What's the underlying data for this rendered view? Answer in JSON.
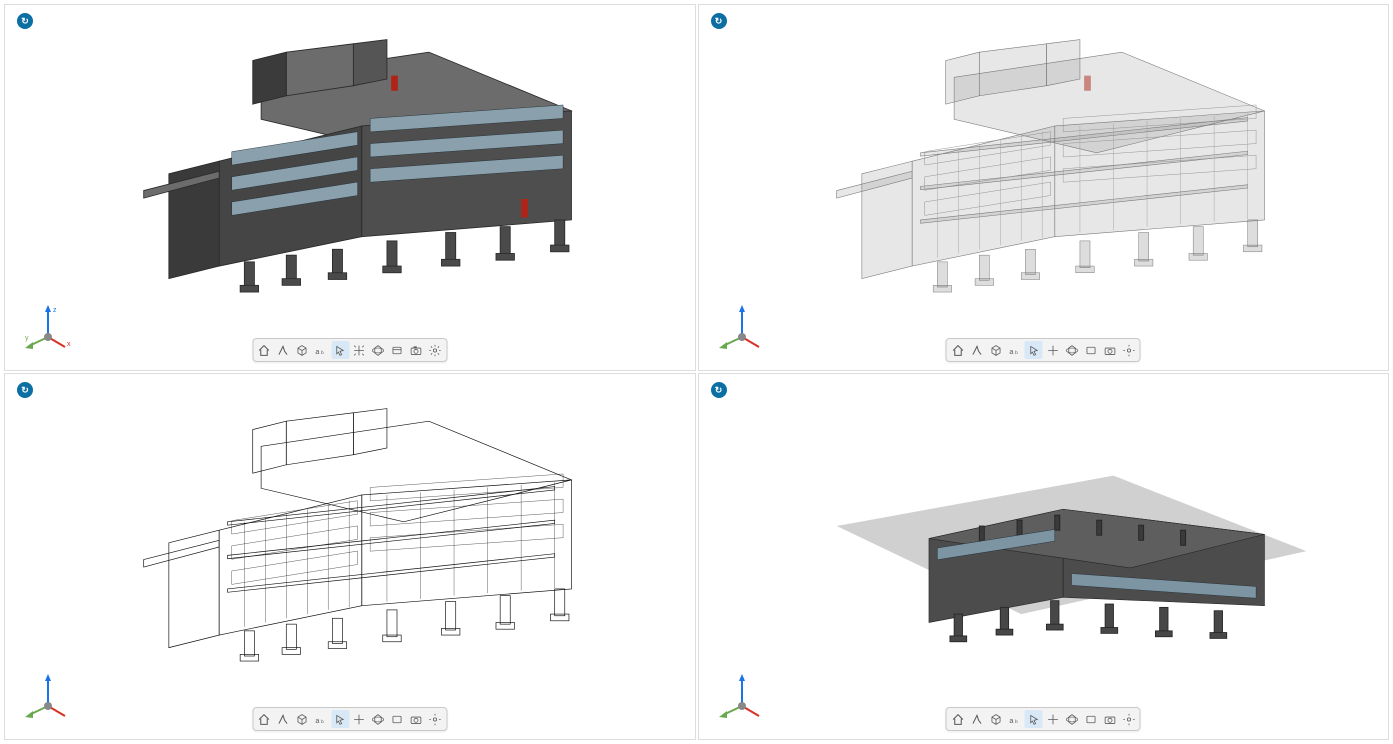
{
  "viewports": [
    {
      "name": "top-left",
      "render_style": "shaded",
      "badge": "•"
    },
    {
      "name": "top-right",
      "render_style": "ghost",
      "badge": "•"
    },
    {
      "name": "bottom-left",
      "render_style": "wireframe",
      "badge": "•"
    },
    {
      "name": "bottom-right",
      "render_style": "section-shaded",
      "badge": "•"
    }
  ],
  "axis": {
    "x_label": "x",
    "y_label": "y",
    "z_label": "z",
    "x_color": "#6aa84f",
    "y_color": "#d93025",
    "z_color": "#1a73e8"
  },
  "toolbar_items": [
    {
      "name": "home",
      "title": "Home View"
    },
    {
      "name": "walk",
      "title": "Walk"
    },
    {
      "name": "box",
      "title": "Section Box"
    },
    {
      "name": "text-size",
      "title": "Text Size"
    },
    {
      "name": "select",
      "title": "Select",
      "active": true
    },
    {
      "name": "pan",
      "title": "Pan"
    },
    {
      "name": "orbit",
      "title": "Orbit"
    },
    {
      "name": "look",
      "title": "Look"
    },
    {
      "name": "camera",
      "title": "Camera"
    },
    {
      "name": "settings",
      "title": "Settings"
    }
  ]
}
